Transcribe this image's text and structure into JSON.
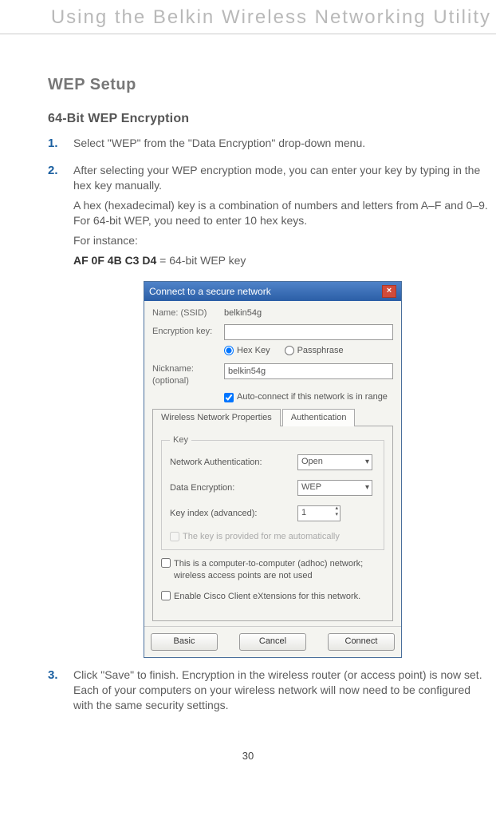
{
  "header": {
    "title": "Using the Belkin Wireless Networking Utility"
  },
  "content": {
    "section_title": "WEP Setup",
    "sub_heading": "64-Bit WEP Encryption",
    "step1": {
      "num": "1.",
      "text": "Select \"WEP\" from the \"Data Encryption\" drop-down menu."
    },
    "step2": {
      "num": "2.",
      "p1": "After selecting your WEP encryption mode, you can enter your key by typing in the hex key manually.",
      "p2": "A hex (hexadecimal) key is a combination of numbers and letters from A–F and 0–9. For 64-bit WEP, you need to enter 10 hex keys.",
      "p3": "For instance:",
      "p4_bold": "AF 0F 4B C3 D4",
      "p4_rest": " = 64-bit WEP key"
    },
    "step3": {
      "num": "3.",
      "text": "Click \"Save\" to finish. Encryption in the wireless router (or access point) is now set. Each of your computers on your wireless network will now need to be configured with the same security settings."
    }
  },
  "dialog": {
    "title": "Connect to a secure network",
    "labels": {
      "name": "Name:  (SSID)",
      "enc_key": "Encryption key:",
      "hex": "Hex Key",
      "pass": "Passphrase",
      "nick": "Nickname:",
      "nick_sub": "(optional)",
      "autoconnect": "Auto-connect if this network is in range"
    },
    "values": {
      "ssid": "belkin54g",
      "nickname": "belkin54g"
    },
    "tabs": {
      "props": "Wireless Network Properties",
      "auth": "Authentication"
    },
    "keybox": {
      "legend": "Key",
      "net_auth_lbl": "Network Authentication:",
      "net_auth_val": "Open",
      "data_enc_lbl": "Data Encryption:",
      "data_enc_val": "WEP",
      "key_index_lbl": "Key index (advanced):",
      "key_index_val": "1",
      "auto_key": "The key is provided for me automatically"
    },
    "adhoc": "This is a computer-to-computer (adhoc) network; wireless access points are not used",
    "cisco": "Enable Cisco Client eXtensions for this network.",
    "buttons": {
      "basic": "Basic",
      "cancel": "Cancel",
      "connect": "Connect"
    }
  },
  "page_number": "30"
}
